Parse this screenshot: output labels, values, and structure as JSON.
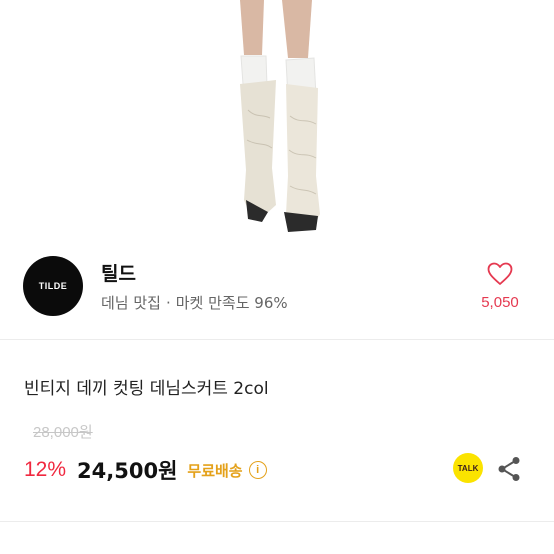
{
  "store": {
    "logo_text": "TILDE",
    "name": "틸드",
    "category": "데님 맛집",
    "separator": "·",
    "rating_label": "마켓 만족도 96%",
    "like_count": "5,050"
  },
  "product": {
    "title": "빈티지 데끼 컷팅 데님스커트 2col",
    "original_price": "28,000원",
    "discount": "12%",
    "price": "24,500원",
    "shipping": "무료배송",
    "info_glyph": "i"
  },
  "actions": {
    "talk_label": "TALK"
  },
  "icons": {
    "like": "heart-outline-icon",
    "share": "share-icon",
    "info": "info-circle-icon"
  },
  "colors": {
    "accent_red": "#f0283f",
    "like_red": "#e53950",
    "shipping_gold": "#e4a11a",
    "talk_yellow": "#fbe300"
  }
}
